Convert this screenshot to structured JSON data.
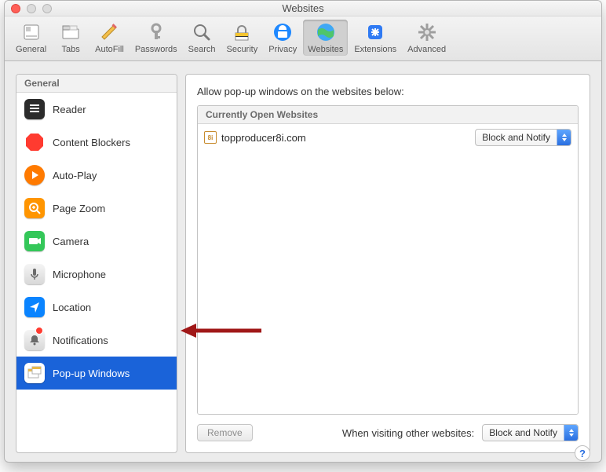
{
  "window": {
    "title": "Websites"
  },
  "toolbar": {
    "items": [
      {
        "label": "General"
      },
      {
        "label": "Tabs"
      },
      {
        "label": "AutoFill"
      },
      {
        "label": "Passwords"
      },
      {
        "label": "Search"
      },
      {
        "label": "Security"
      },
      {
        "label": "Privacy"
      },
      {
        "label": "Websites"
      },
      {
        "label": "Extensions"
      },
      {
        "label": "Advanced"
      }
    ]
  },
  "sidebar": {
    "header": "General",
    "items": [
      {
        "label": "Reader"
      },
      {
        "label": "Content Blockers"
      },
      {
        "label": "Auto-Play"
      },
      {
        "label": "Page Zoom"
      },
      {
        "label": "Camera"
      },
      {
        "label": "Microphone"
      },
      {
        "label": "Location"
      },
      {
        "label": "Notifications"
      },
      {
        "label": "Pop-up Windows"
      }
    ]
  },
  "main": {
    "instruction": "Allow pop-up windows on the websites below:",
    "list_header": "Currently Open Websites",
    "rows": [
      {
        "domain": "topproducer8i.com",
        "setting": "Block and Notify"
      }
    ],
    "remove_button": "Remove",
    "other_label": "When visiting other websites:",
    "other_setting": "Block and Notify"
  },
  "help": {
    "glyph": "?"
  }
}
